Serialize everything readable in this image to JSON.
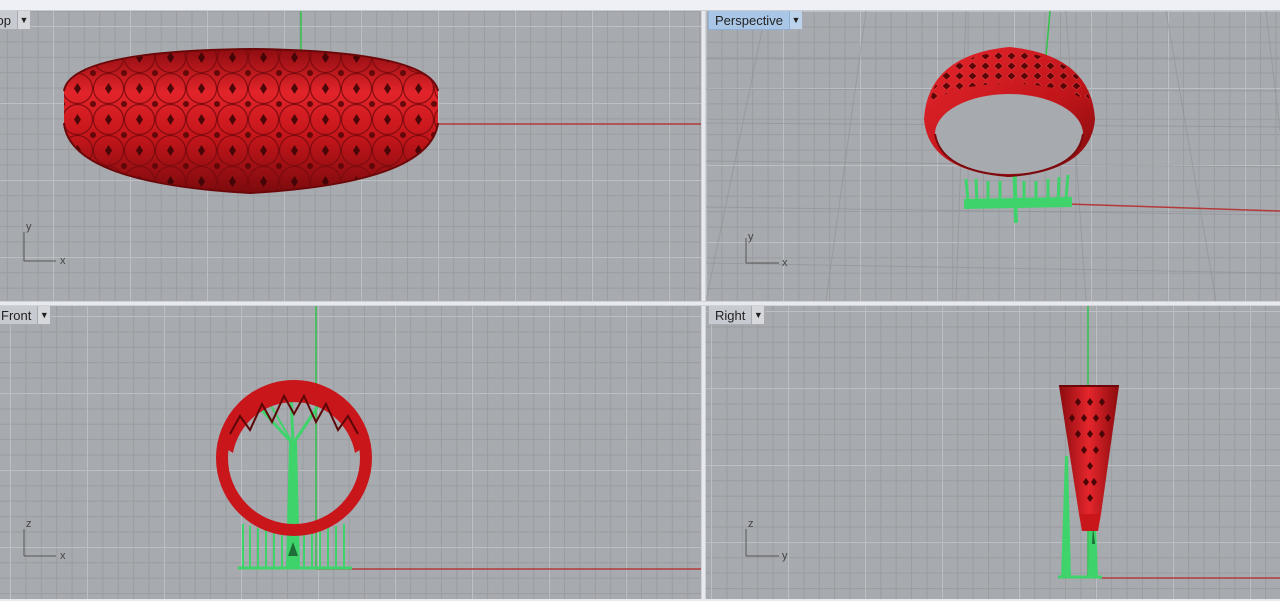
{
  "viewports": {
    "top": {
      "label": "Top",
      "axes": {
        "a": "y",
        "b": "x"
      }
    },
    "perspective": {
      "label": "Perspective",
      "axes": {
        "a": "y",
        "b": "x"
      }
    },
    "front": {
      "label": "Front",
      "axes": {
        "a": "z",
        "b": "x"
      }
    },
    "right": {
      "label": "Right",
      "axes": {
        "a": "z",
        "b": "y"
      }
    }
  },
  "icons": {
    "dropdown": "triangle-down-icon"
  },
  "colors": {
    "model": "#c8161b",
    "supports": "#3fd46b",
    "x_axis": "#b33a3a",
    "y_axis": "#33c24c",
    "active_viewport_tab": "#a9c6e6"
  }
}
